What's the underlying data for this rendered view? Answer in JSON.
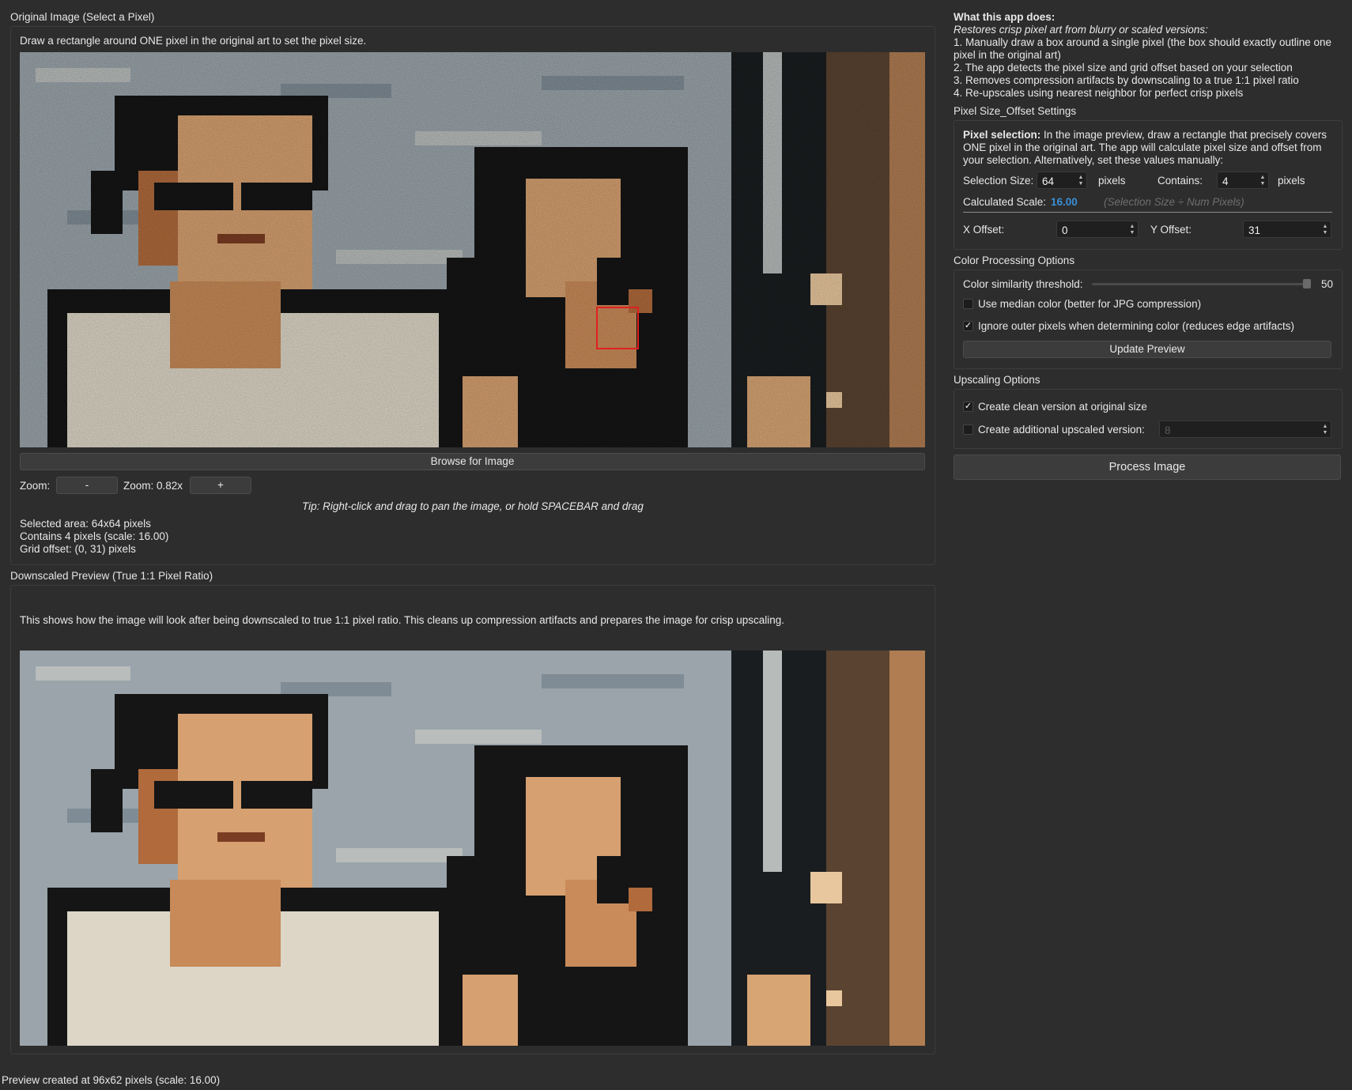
{
  "original_panel": {
    "title": "Original Image (Select a Pixel)",
    "instruction": "Draw a rectangle around ONE pixel in the original art to set the pixel size.",
    "browse_label": "Browse for Image",
    "zoom_label": "Zoom:",
    "zoom_out_label": "-",
    "zoom_value": "Zoom: 0.82x",
    "zoom_in_label": "+",
    "tip": "Tip: Right-click and drag to pan the image, or hold SPACEBAR and drag",
    "selected_area": "Selected area: 64x64 pixels",
    "contains": "Contains 4 pixels (scale: 16.00)",
    "grid_offset": "Grid offset: (0, 31) pixels"
  },
  "downscaled_panel": {
    "title": "Downscaled Preview (True 1:1 Pixel Ratio)",
    "description": "This shows how the image will look after being downscaled to true 1:1 pixel ratio. This cleans up compression artifacts and prepares the image for crisp upscaling."
  },
  "about": {
    "heading": "What this app does:",
    "subtitle": "Restores crisp pixel art from blurry or scaled versions:",
    "step1a": "1. Manually draw a box around a single pixel (the box should exactly outline one",
    "step1b": "pixel in the original art)",
    "step2": "2. The app detects the pixel size and grid offset based on your selection",
    "step3": "3. Removes compression artifacts by downscaling to a true 1:1 pixel ratio",
    "step4": "4. Re-upscales using nearest neighbor for perfect crisp pixels"
  },
  "pixel_settings": {
    "title": "Pixel Size_Offset Settings",
    "desc_bold": "Pixel selection:",
    "desc_line1": " In the image preview, draw a rectangle that precisely covers",
    "desc_line2": "ONE pixel in the original art. The app will calculate pixel size and offset from",
    "desc_line3": "your selection. Alternatively, set these values manually:",
    "selection_size_label": "Selection Size:",
    "selection_size_value": "64",
    "selection_unit": "pixels",
    "contains_label": "Contains:",
    "contains_value": "4",
    "contains_unit": "pixels",
    "calculated_label": "Calculated Scale:",
    "calculated_value": "16.00",
    "calculated_hint": "(Selection Size ÷ Num Pixels)",
    "x_offset_label": "X Offset:",
    "x_offset_value": "0",
    "y_offset_label": "Y Offset:",
    "y_offset_value": "31"
  },
  "color_options": {
    "title": "Color Processing Options",
    "threshold_label": "Color similarity threshold:",
    "threshold_value": "50",
    "median_label": "Use median color (better for JPG compression)",
    "median_checked": false,
    "ignore_label": "Ignore outer pixels when determining color (reduces edge artifacts)",
    "ignore_checked": true,
    "update_label": "Update Preview"
  },
  "upscaling": {
    "title": "Upscaling Options",
    "clean_label": "Create clean version at original size",
    "clean_checked": true,
    "additional_label": "Create additional upscaled version:",
    "additional_checked": false,
    "additional_value": "8"
  },
  "process_label": "Process Image",
  "status_bar": "Preview created at 96x62 pixels (scale: 16.00)",
  "colors": {
    "background": "#2d2d2d",
    "accent_scale": "#3a8fd6",
    "selection_box": "#e02020",
    "wall": "#9aa4aa",
    "hair": "#151515",
    "skin": "#d6a070",
    "shirt": "#ddd6c7",
    "door": "#5a4330"
  }
}
